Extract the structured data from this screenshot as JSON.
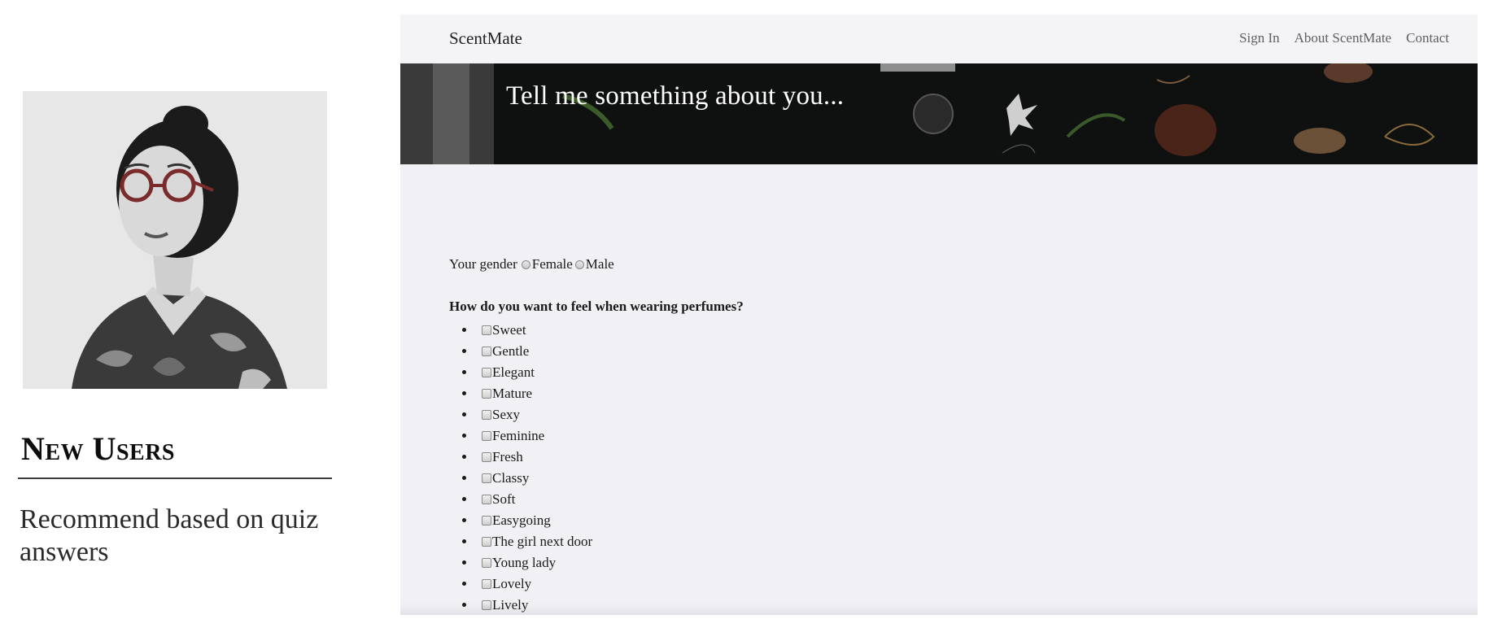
{
  "persona": {
    "photo_alt": "woman-with-glasses-portrait",
    "title": "New Users",
    "description": "Recommend based on quiz answers"
  },
  "site": {
    "brand": "ScentMate",
    "nav": [
      "Sign In",
      "About ScentMate",
      "Contact"
    ],
    "hero_title": "Tell me something about you..."
  },
  "quiz": {
    "gender_label": "Your gender",
    "gender_options": [
      "Female",
      "Male"
    ],
    "question": "How do you want to feel when wearing perfumes?",
    "options": [
      "Sweet",
      "Gentle",
      "Elegant",
      "Mature",
      "Sexy",
      "Feminine",
      "Fresh",
      "Classy",
      "Soft",
      "Easygoing",
      "The girl next door",
      "Young lady",
      "Lovely",
      "Lively"
    ]
  }
}
